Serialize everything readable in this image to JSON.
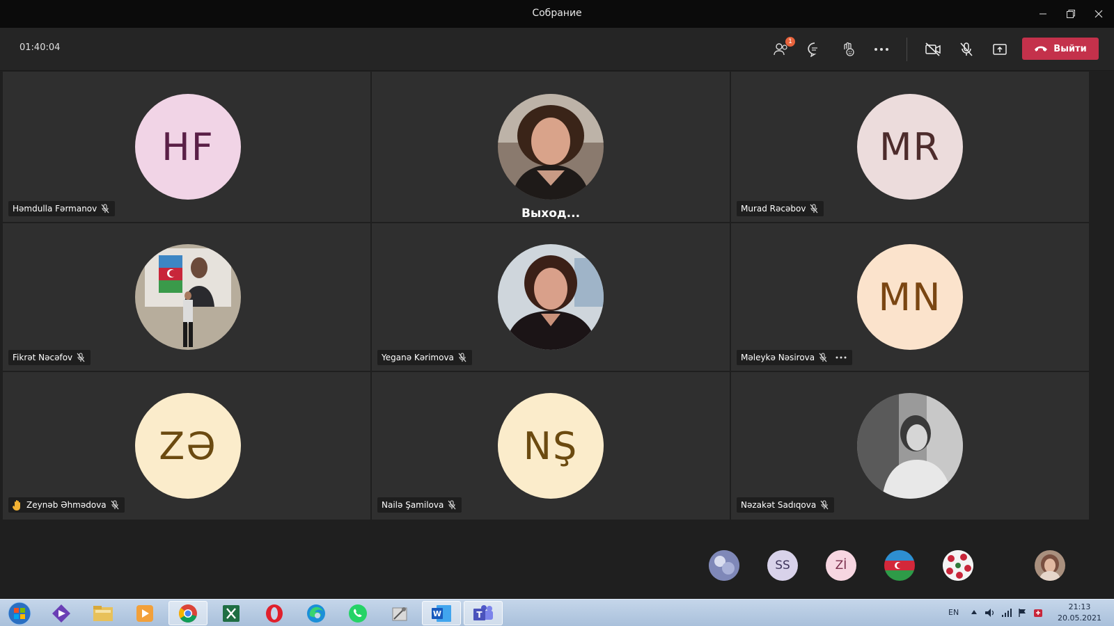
{
  "window": {
    "title": "Собрание"
  },
  "toolbar": {
    "timer": "01:40:04",
    "participants_badge": "1",
    "leave_label": "Выйти"
  },
  "tiles": [
    {
      "name": "Həmdulla Fərmanov",
      "initials": "HF",
      "bg": "#f1d4e6",
      "fg": "#5a1f47"
    },
    {
      "leaving_label": "Выход..."
    },
    {
      "name": "Murad Rəcəbov",
      "initials": "MR",
      "bg": "#ecdcdc",
      "fg": "#4d2c2c"
    },
    {
      "name": "Fikrət Nəcəfov"
    },
    {
      "name": "Yeganə Kərimova"
    },
    {
      "name": "Məleykə Nəsirova",
      "initials": "MN",
      "bg": "#fbe3cc",
      "fg": "#7a4612"
    },
    {
      "name": "Zeynəb Əhmədova",
      "initials": "ZƏ",
      "bg": "#fbeccb",
      "fg": "#6b4a10"
    },
    {
      "name": "Nailə Şamilova",
      "initials": "NŞ",
      "bg": "#fbeccb",
      "fg": "#6b4a10"
    },
    {
      "name": "Nəzakət Sadıqova"
    }
  ],
  "mini_participants": [
    {
      "initials": ""
    },
    {
      "initials": "SS",
      "bg": "#d8d2ea",
      "fg": "#3e355c"
    },
    {
      "initials": "Zİ",
      "bg": "#f7d6e1",
      "fg": "#7a2d4b"
    },
    {
      "initials": ""
    },
    {
      "initials": ""
    }
  ],
  "taskbar": {
    "language": "EN",
    "time": "21:13",
    "date": "20.05.2021"
  }
}
